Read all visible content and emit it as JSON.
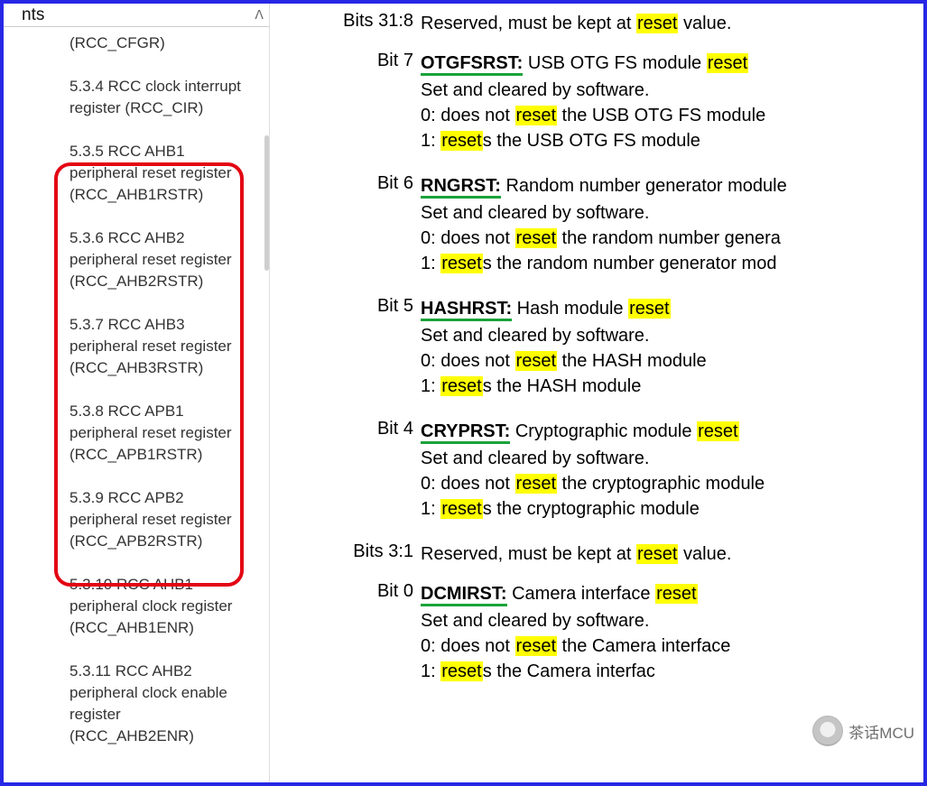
{
  "sidebar": {
    "title_fragment": "nts",
    "items": [
      "(RCC_CFGR)",
      "5.3.4 RCC clock interrupt register (RCC_CIR)",
      "5.3.5 RCC AHB1 peripheral reset register (RCC_AHB1RSTR)",
      "5.3.6 RCC AHB2 peripheral reset register (RCC_AHB2RSTR)",
      "5.3.7 RCC AHB3 peripheral reset register (RCC_AHB3RSTR)",
      "5.3.8 RCC APB1 peripheral reset register (RCC_APB1RSTR)",
      "5.3.9 RCC APB2 peripheral reset register (RCC_APB2RSTR)",
      "5.3.10 RCC AHB1 peripheral clock register (RCC_AHB1ENR)",
      "5.3.11 RCC AHB2 peripheral clock enable register (RCC_AHB2ENR)"
    ]
  },
  "bits": [
    {
      "label": "Bits 31:8",
      "plain_head": "Reserved, must be kept at ",
      "plain_tail": " value.",
      "mark": "reset"
    },
    {
      "label": "Bit 7",
      "name": "OTGFSRST:",
      "title_a": " USB OTG FS module ",
      "title_mark": "reset",
      "setclr": "Set and cleared by software.",
      "z_a": "0: does not ",
      "z_mark": "reset",
      "z_b": " the USB OTG FS module",
      "o_mark": "reset",
      "o_b": "s the USB OTG FS module",
      "o_a": "1: "
    },
    {
      "label": "Bit 6",
      "name": "RNGRST:",
      "title_a": " Random number generator module ",
      "title_mark": "",
      "setclr": "Set and cleared by software.",
      "z_a": "0: does not ",
      "z_mark": "reset",
      "z_b": " the random number genera",
      "o_mark": "reset",
      "o_b": "s the random number generator mod",
      "o_a": "1: "
    },
    {
      "label": "Bit 5",
      "name": "HASHRST:",
      "title_a": " Hash module ",
      "title_mark": "reset",
      "setclr": "Set and cleared by software.",
      "z_a": "0: does not ",
      "z_mark": "reset",
      "z_b": " the HASH module",
      "o_mark": "reset",
      "o_b": "s the HASH module",
      "o_a": "1: "
    },
    {
      "label": "Bit 4",
      "name": "CRYPRST:",
      "title_a": " Cryptographic module ",
      "title_mark": "reset",
      "setclr": "Set and cleared by software.",
      "z_a": "0: does not ",
      "z_mark": "reset",
      "z_b": " the cryptographic module",
      "o_mark": "reset",
      "o_b": "s the cryptographic module",
      "o_a": "1: "
    },
    {
      "label": "Bits 3:1",
      "plain_head": "Reserved, must be kept at ",
      "plain_tail": " value.",
      "mark": "reset"
    },
    {
      "label": "Bit 0",
      "name": "DCMIRST:",
      "title_a": " Camera interface ",
      "title_mark": "reset",
      "setclr": "Set and cleared by software.",
      "z_a": "0: does not ",
      "z_mark": "reset",
      "z_b": " the Camera interface",
      "o_mark": "reset",
      "o_b": "s the Camera interfac",
      "o_a": "1: "
    }
  ],
  "watermark": "茶话MCU"
}
